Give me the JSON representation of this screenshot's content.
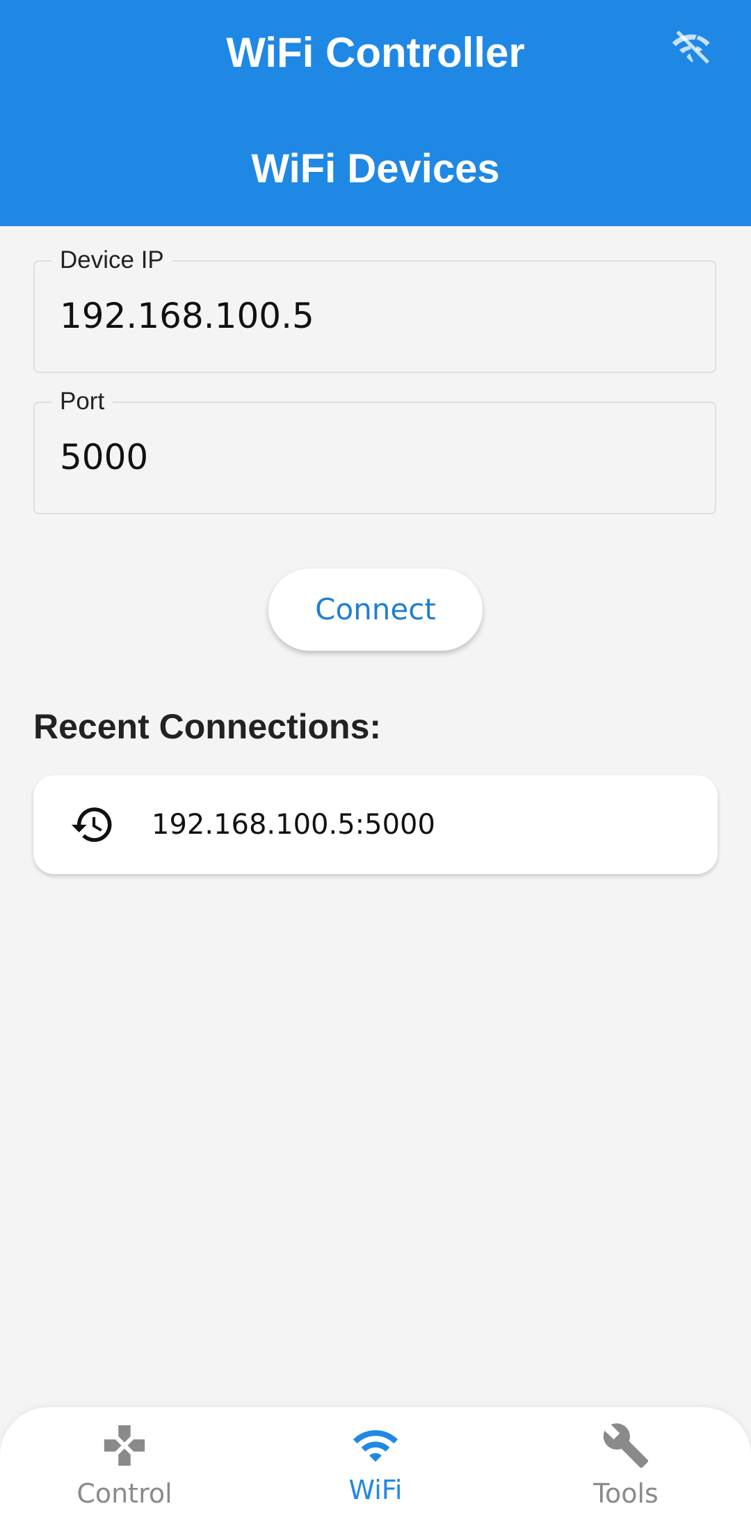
{
  "appbar": {
    "title": "WiFi Controller",
    "status_icon": "wifi-off-icon",
    "page_heading": "WiFi Devices"
  },
  "form": {
    "ip": {
      "label": "Device IP",
      "value": "192.168.100.5"
    },
    "port": {
      "label": "Port",
      "value": "5000"
    },
    "connect_label": "Connect"
  },
  "recent": {
    "title": "Recent Connections:",
    "items": [
      {
        "icon": "history-icon",
        "text": "192.168.100.5:5000"
      }
    ]
  },
  "bottom_nav": {
    "items": [
      {
        "label": "Control",
        "icon": "gamepad-icon",
        "active": false
      },
      {
        "label": "WiFi",
        "icon": "wifi-icon",
        "active": true
      },
      {
        "label": "Tools",
        "icon": "wrench-icon",
        "active": false
      }
    ]
  },
  "colors": {
    "primary": "#1f88e5",
    "background": "#f4f4f4",
    "nav_inactive": "#8a8a8a",
    "nav_active": "#1f88e5"
  }
}
